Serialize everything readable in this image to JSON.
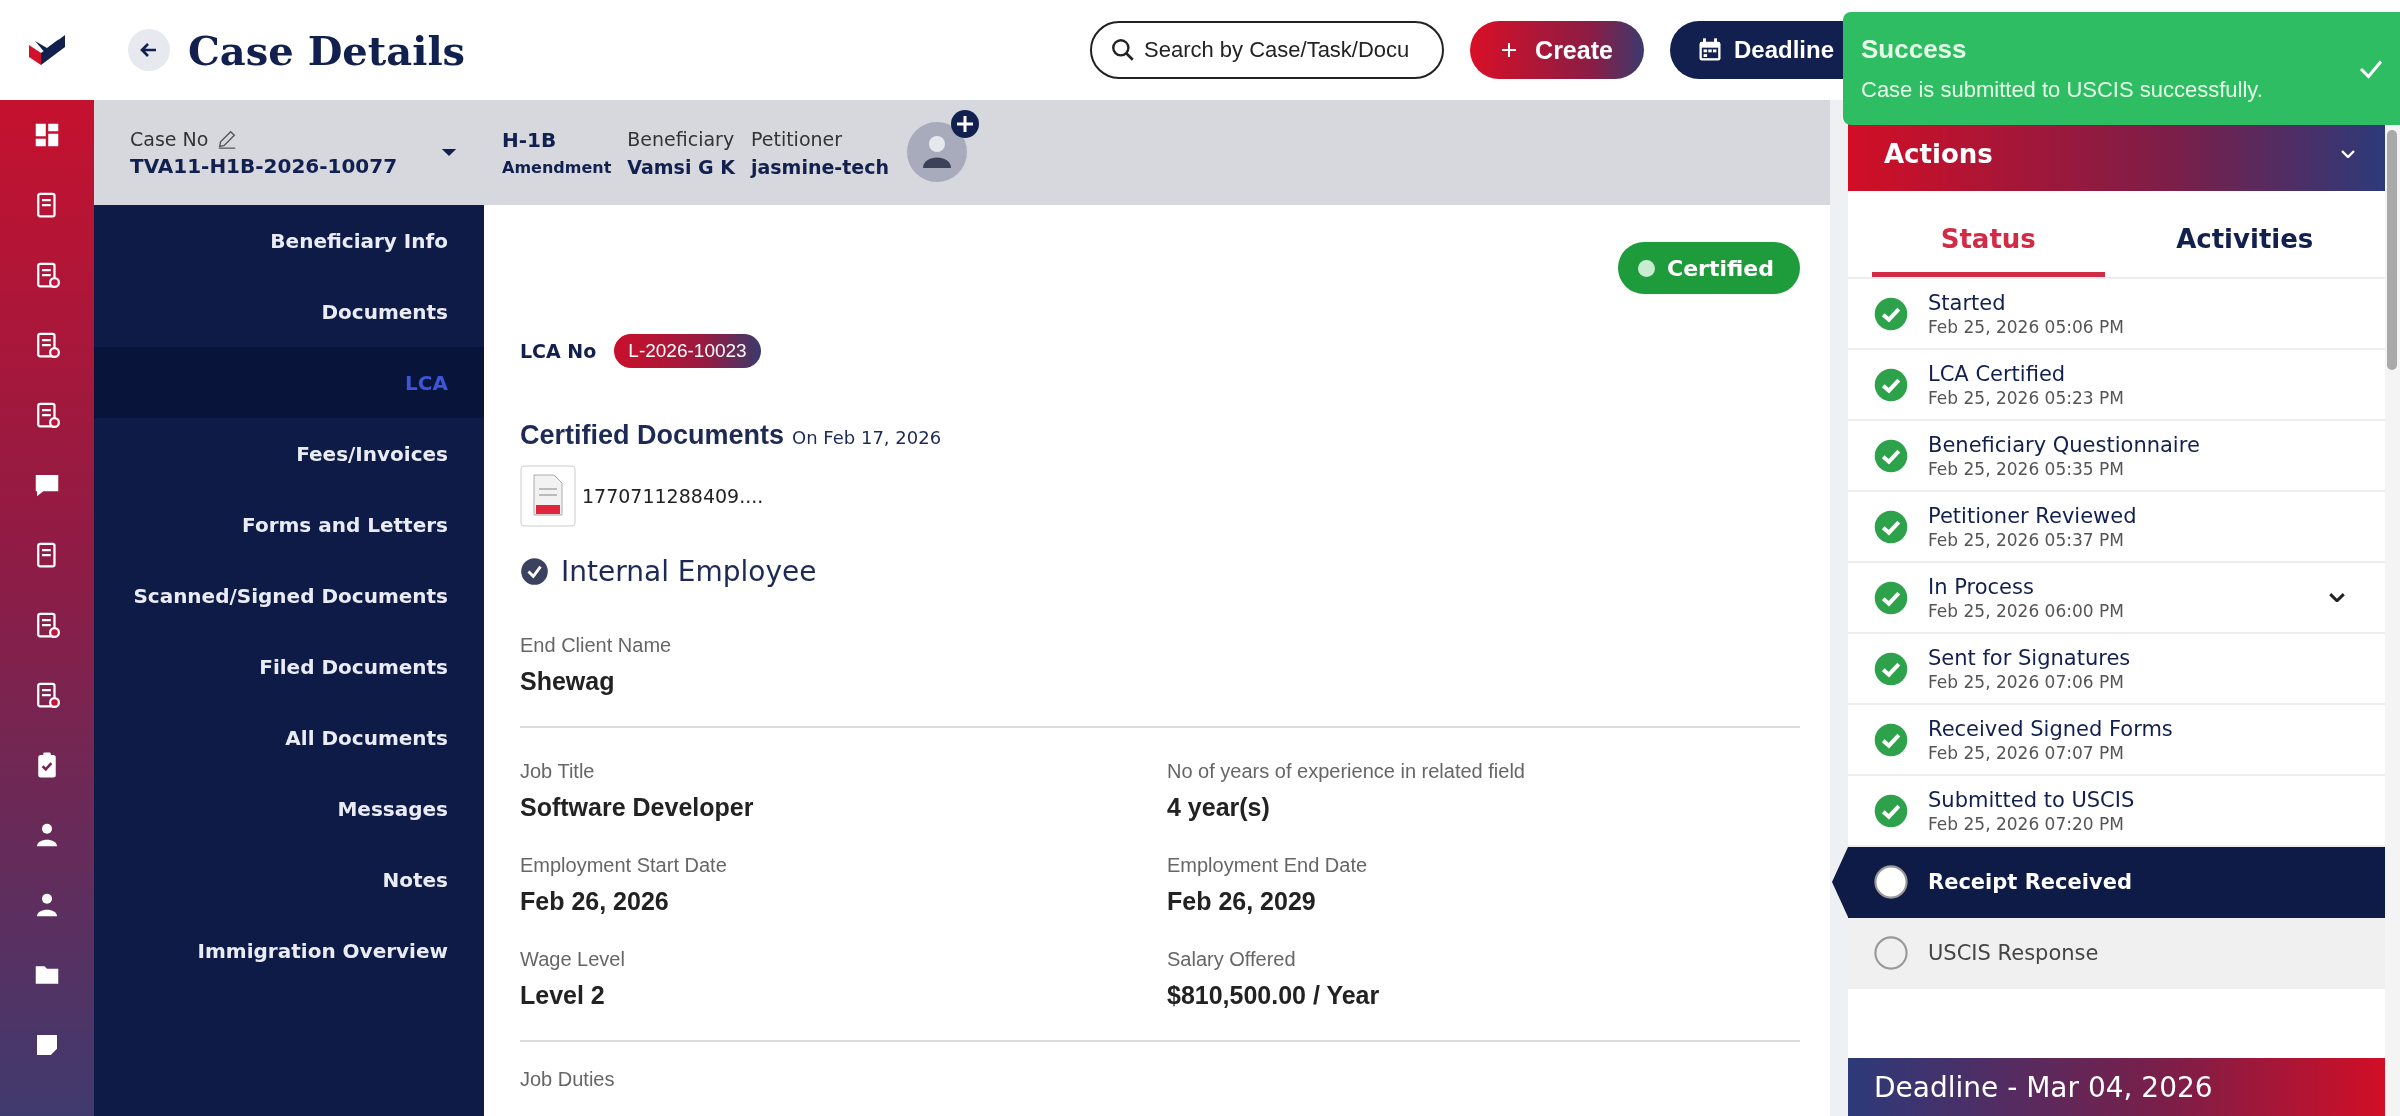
{
  "header": {
    "title": "Case Details",
    "search": {
      "placeholder": "Search by Case/Task/Docu"
    },
    "create_button": "Create",
    "deadline_button": "Deadline"
  },
  "toast": {
    "title": "Success",
    "message": "Case is submitted to USCIS successfully."
  },
  "case_bar": {
    "case_no_label": "Case No",
    "case_no": "TVA11-H1B-2026-10077",
    "visa_type": "H-1B",
    "visa_subtype": "Amendment",
    "beneficiary_label": "Beneficiary",
    "beneficiary": "Vamsi G K",
    "petitioner_label": "Petitioner",
    "petitioner": "jasmine-tech"
  },
  "nav": [
    {
      "label": "Beneficiary Info",
      "selected": false
    },
    {
      "label": "Documents",
      "selected": false
    },
    {
      "label": "LCA",
      "selected": true
    },
    {
      "label": "Fees/Invoices",
      "selected": false
    },
    {
      "label": "Forms and Letters",
      "selected": false
    },
    {
      "label": "Scanned/Signed Documents",
      "selected": false
    },
    {
      "label": "Filed Documents",
      "selected": false
    },
    {
      "label": "All Documents",
      "selected": false
    },
    {
      "label": "Messages",
      "selected": false
    },
    {
      "label": "Notes",
      "selected": false
    },
    {
      "label": "Immigration Overview",
      "selected": false
    }
  ],
  "content": {
    "status_badge": "Certified",
    "lca_label": "LCA No",
    "lca_no": "L-2026-10023",
    "certified_docs_title": "Certified Documents",
    "certified_docs_date": "On Feb 17, 2026",
    "file_name": "1770711288409....",
    "employee_type": "Internal Employee",
    "end_client": {
      "label": "End Client Name",
      "value": "Shewag"
    },
    "fields": [
      {
        "label": "Job Title",
        "value": "Software Developer"
      },
      {
        "label": "No of years of experience in related field",
        "value": "4 year(s)"
      },
      {
        "label": "Employment Start Date",
        "value": "Feb 26, 2026"
      },
      {
        "label": "Employment End Date",
        "value": "Feb 26, 2029"
      },
      {
        "label": "Wage Level",
        "value": "Level 2"
      },
      {
        "label": "Salary Offered",
        "value": "$810,500.00 / Year"
      }
    ],
    "job_duties_label": "Job Duties"
  },
  "actions": {
    "title": "Actions",
    "tabs": [
      {
        "label": "Status",
        "selected": true
      },
      {
        "label": "Activities",
        "selected": false
      }
    ],
    "steps": [
      {
        "kind": "step",
        "title": "Started",
        "date": "Feb 25, 2026 05:06 PM",
        "completed": true,
        "selected": false
      },
      {
        "kind": "step",
        "title": "LCA Certified",
        "date": "Feb 25, 2026 05:23 PM",
        "completed": true,
        "selected": false
      },
      {
        "kind": "step",
        "title": "Beneficiary Questionnaire",
        "date": "Feb 25, 2026 05:35 PM",
        "completed": true,
        "selected": false
      },
      {
        "kind": "step",
        "title": "Petitioner Reviewed",
        "date": "Feb 25, 2026 05:37 PM",
        "completed": true,
        "selected": false
      },
      {
        "kind": "expandable",
        "title": "In Process",
        "date": "Feb 25, 2026 06:00 PM",
        "completed": true,
        "selected": false
      },
      {
        "kind": "step",
        "title": "Sent for Signatures",
        "date": "Feb 25, 2026 07:06 PM",
        "completed": true,
        "selected": false
      },
      {
        "kind": "step",
        "title": "Received Signed Forms",
        "date": "Feb 25, 2026 07:07 PM",
        "completed": true,
        "selected": false
      },
      {
        "kind": "step",
        "title": "Submitted to USCIS",
        "date": "Feb 25, 2026 07:20 PM",
        "completed": true,
        "selected": false
      },
      {
        "kind": "step",
        "title": "Receipt Received",
        "completed": false,
        "selected": true
      },
      {
        "kind": "step",
        "title": "USCIS Response",
        "completed": false,
        "selected": false
      }
    ],
    "deadline": "Deadline - Mar 04, 2026"
  }
}
